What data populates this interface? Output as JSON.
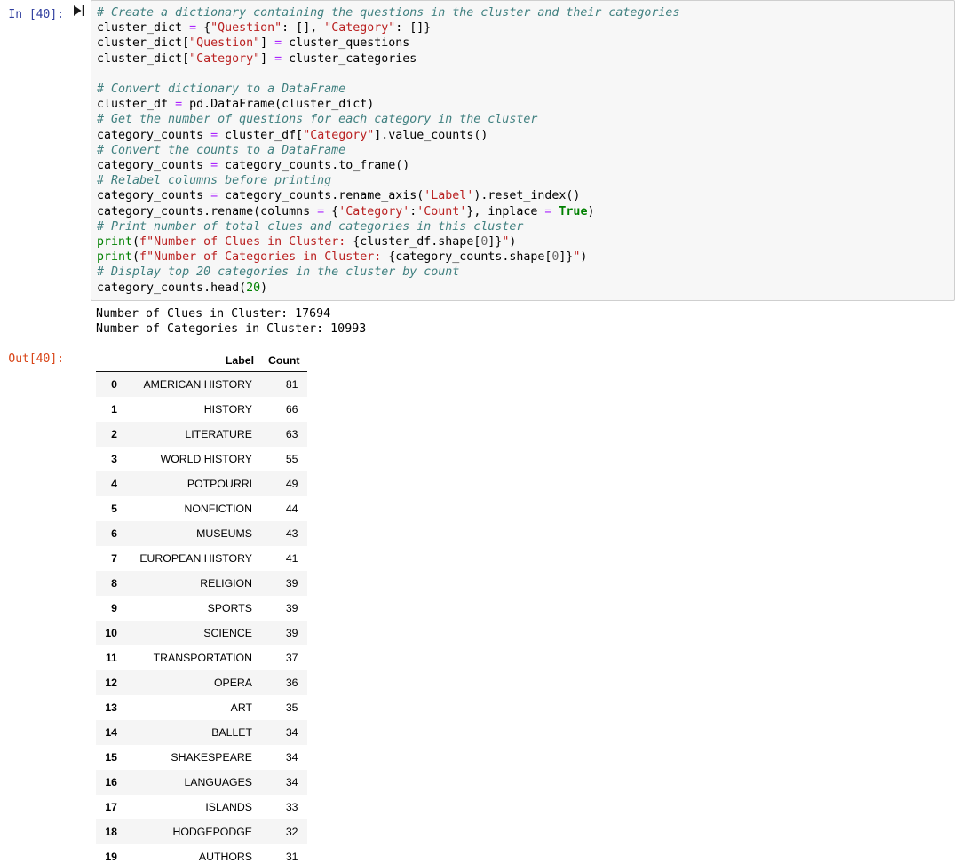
{
  "cell": {
    "input_prompt": "In [40]:",
    "output_prompt": "Out[40]:",
    "run_indicator_icon": "play-bar-icon",
    "code_lines": [
      {
        "id": "l1",
        "text": "# Create a dictionary containing the questions in the cluster and their categories"
      },
      {
        "id": "l2",
        "text": "cluster_dict = {\"Question\": [], \"Category\": []}"
      },
      {
        "id": "l3",
        "text": "cluster_dict[\"Question\"] = cluster_questions"
      },
      {
        "id": "l4",
        "text": "cluster_dict[\"Category\"] = cluster_categories"
      },
      {
        "id": "l5",
        "text": ""
      },
      {
        "id": "l6",
        "text": "# Convert dictionary to a DataFrame"
      },
      {
        "id": "l7",
        "text": "cluster_df = pd.DataFrame(cluster_dict)"
      },
      {
        "id": "l8",
        "text": "# Get the number of questions for each category in the cluster"
      },
      {
        "id": "l9",
        "text": "category_counts = cluster_df[\"Category\"].value_counts()"
      },
      {
        "id": "l10",
        "text": "# Convert the counts to a DataFrame"
      },
      {
        "id": "l11",
        "text": "category_counts = category_counts.to_frame()"
      },
      {
        "id": "l12",
        "text": "# Relabel columns before printing"
      },
      {
        "id": "l13",
        "text": "category_counts = category_counts.rename_axis('Label').reset_index()"
      },
      {
        "id": "l14",
        "text": "category_counts.rename(columns = {'Category':'Count'}, inplace = True)"
      },
      {
        "id": "l15",
        "text": "# Print number of total clues and categories in this cluster"
      },
      {
        "id": "l16",
        "text": "print(f\"Number of Clues in Cluster: {cluster_df.shape[0]}\")"
      },
      {
        "id": "l17",
        "text": "print(f\"Number of Categories in Cluster: {category_counts.shape[0]}\")"
      },
      {
        "id": "l18",
        "text": "# Display top 20 categories in the cluster by count"
      },
      {
        "id": "l19",
        "text": "category_counts.head(20)"
      }
    ],
    "stdout": "Number of Clues in Cluster: 17694\nNumber of Categories in Cluster: 10993",
    "stdout_lines": [
      "Number of Clues in Cluster: 17694",
      "Number of Categories in Cluster: 10993"
    ]
  },
  "dataframe": {
    "columns": [
      "Label",
      "Count"
    ],
    "index_header": "",
    "rows": [
      {
        "index": "0",
        "Label": "AMERICAN HISTORY",
        "Count": "81"
      },
      {
        "index": "1",
        "Label": "HISTORY",
        "Count": "66"
      },
      {
        "index": "2",
        "Label": "LITERATURE",
        "Count": "63"
      },
      {
        "index": "3",
        "Label": "WORLD HISTORY",
        "Count": "55"
      },
      {
        "index": "4",
        "Label": "POTPOURRI",
        "Count": "49"
      },
      {
        "index": "5",
        "Label": "NONFICTION",
        "Count": "44"
      },
      {
        "index": "6",
        "Label": "MUSEUMS",
        "Count": "43"
      },
      {
        "index": "7",
        "Label": "EUROPEAN HISTORY",
        "Count": "41"
      },
      {
        "index": "8",
        "Label": "RELIGION",
        "Count": "39"
      },
      {
        "index": "9",
        "Label": "SPORTS",
        "Count": "39"
      },
      {
        "index": "10",
        "Label": "SCIENCE",
        "Count": "39"
      },
      {
        "index": "11",
        "Label": "TRANSPORTATION",
        "Count": "37"
      },
      {
        "index": "12",
        "Label": "OPERA",
        "Count": "36"
      },
      {
        "index": "13",
        "Label": "ART",
        "Count": "35"
      },
      {
        "index": "14",
        "Label": "BALLET",
        "Count": "34"
      },
      {
        "index": "15",
        "Label": "SHAKESPEARE",
        "Count": "34"
      },
      {
        "index": "16",
        "Label": "LANGUAGES",
        "Count": "34"
      },
      {
        "index": "17",
        "Label": "ISLANDS",
        "Count": "33"
      },
      {
        "index": "18",
        "Label": "HODGEPODGE",
        "Count": "32"
      },
      {
        "index": "19",
        "Label": "AUTHORS",
        "Count": "31"
      }
    ]
  },
  "colors": {
    "prompt_in": "#303F9F",
    "prompt_out": "#D84315",
    "comment": "#408080",
    "string": "#BA2121",
    "keyword": "#008000",
    "operator": "#AA22FF",
    "number": "#008000",
    "cell_background": "#f7f7f7",
    "cell_border": "#cfcfcf",
    "table_stripe": "#f5f5f5"
  }
}
